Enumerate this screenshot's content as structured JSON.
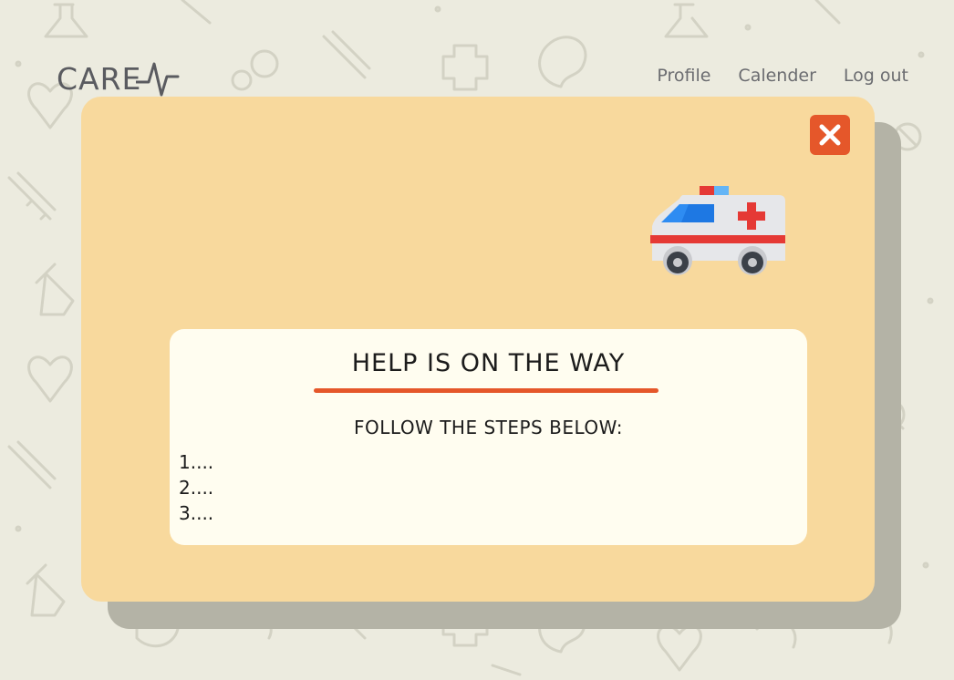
{
  "header": {
    "logo_text": "CARE",
    "nav": [
      "Profile",
      "Calender",
      "Log out"
    ]
  },
  "modal": {
    "title": "HELP IS ON THE WAY",
    "subtitle": "FOLLOW THE STEPS BELOW:",
    "steps": [
      "1....",
      "2....",
      "3...."
    ],
    "close_icon": "close-x-icon",
    "illustration_icon": "ambulance-icon"
  },
  "colors": {
    "background": "#ecebdf",
    "modal": "#f8d99d",
    "modal_shadow": "#b4b3a6",
    "card": "#fffdf0",
    "accent": "#e5572a",
    "text": "#1c1c1c",
    "logo": "#5a5b60"
  }
}
